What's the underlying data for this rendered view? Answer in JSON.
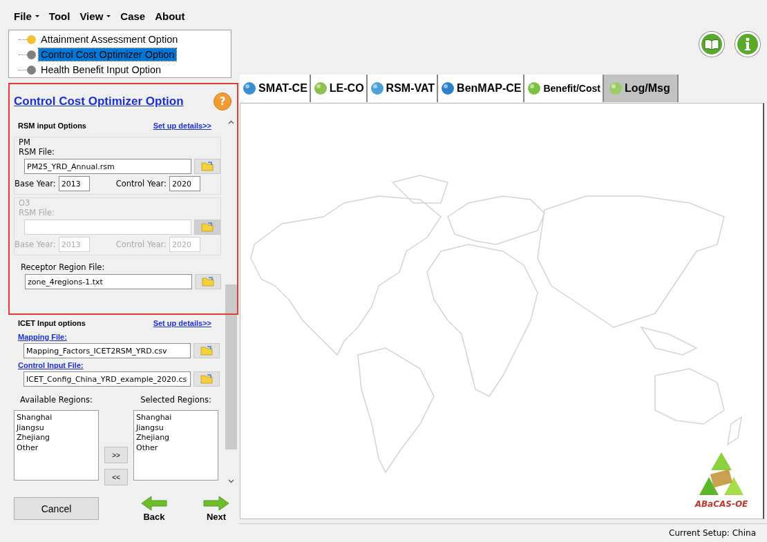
{
  "menu": [
    {
      "label": "File",
      "dropdown": true
    },
    {
      "label": "Tool",
      "dropdown": false
    },
    {
      "label": "View",
      "dropdown": true
    },
    {
      "label": "Case",
      "dropdown": false
    },
    {
      "label": "About",
      "dropdown": false
    }
  ],
  "tree": [
    {
      "label": "Attainment Assessment Option",
      "color": "#f2c230",
      "selected": false
    },
    {
      "label": "Control Cost Optimizer Option",
      "color": "#808080",
      "selected": true
    },
    {
      "label": "Health Benefit Input Option",
      "color": "#808080",
      "selected": false
    }
  ],
  "panel": {
    "title": "Control Cost Optimizer Option",
    "help": "?",
    "rsm": {
      "heading": "RSM input Options",
      "link": "Set up details>>",
      "groups": [
        {
          "legend": "PM",
          "disabled": false,
          "file_label": "RSM File:",
          "file_value": "PM25_YRD_Annual.rsm",
          "base_label": "Base Year:",
          "base_value": "2013",
          "control_label": "Control Year:",
          "control_value": "2020"
        },
        {
          "legend": "O3",
          "disabled": true,
          "file_label": "RSM File:",
          "base_label": "Base Year:",
          "base_value": "2013",
          "control_label": "Control Year:",
          "control_value": "2020"
        }
      ],
      "receptor": {
        "label": "Receptor Region File:",
        "value": "zone_4regions-1.txt"
      }
    },
    "icet": {
      "heading": "ICET Input options",
      "link": "Set up details>>",
      "files": [
        {
          "label": "Mapping File:",
          "value": "Mapping_Factors_ICET2RSM_YRD.csv"
        },
        {
          "label": "Control Input File:",
          "value": "ICET_Config_China_YRD_example_2020.cs"
        }
      ]
    },
    "regions": {
      "available_label": "Available Regions:",
      "available": [
        "Shanghai",
        "Jiangsu",
        "Zhejiang",
        "Other"
      ],
      "selected_label": "Selected Regions:",
      "selected": [
        "Shanghai",
        "Jiangsu",
        "Zhejiang",
        "Other"
      ],
      "add": ">>",
      "remove": "<<"
    }
  },
  "buttons": {
    "cancel": "Cancel",
    "back": "Back",
    "next": "Next"
  },
  "tabs": [
    {
      "label": "SMAT-CE",
      "selected": false
    },
    {
      "label": "LE-CO",
      "selected": false
    },
    {
      "label": "RSM-VAT",
      "selected": false
    },
    {
      "label": "BenMAP-CE",
      "selected": false
    },
    {
      "label": "Benefit/Cost",
      "selected": false
    },
    {
      "label": "Log/Msg",
      "selected": true
    }
  ],
  "logo": "ABaCAS-OE",
  "status_bar": "Current Setup: China"
}
